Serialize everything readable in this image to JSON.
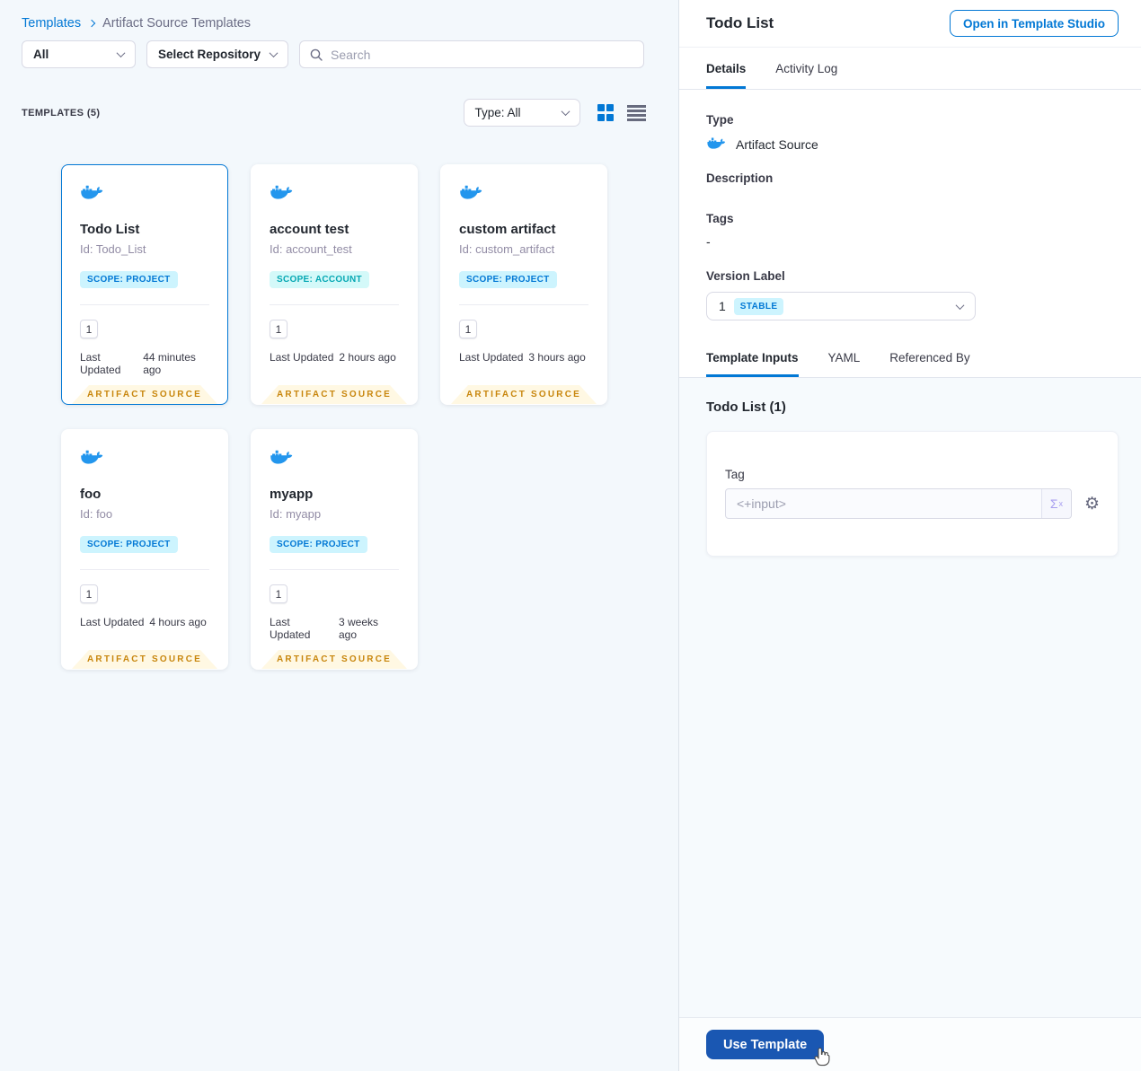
{
  "colors": {
    "primary_blue": "#0278D5",
    "docker_blue": "#2396ED",
    "ribbon_bg": "#FFF8E3",
    "ribbon_text": "#C8860D",
    "scope_project_bg": "#CDF4FE",
    "scope_project_text": "#0278D5",
    "scope_account_bg": "#D4F9F9",
    "scope_account_text": "#06A8B3",
    "use_template_bg": "#1A57B2"
  },
  "breadcrumb": {
    "root": "Templates",
    "current": "Artifact Source Templates"
  },
  "filters": {
    "scope": "All",
    "repository": "Select Repository",
    "search_placeholder": "Search"
  },
  "list_header": {
    "count": "TEMPLATES (5)",
    "type_filter": "Type: All"
  },
  "cards": [
    {
      "title": "Todo List",
      "id": "Id: Todo_List",
      "scope": "project",
      "scope_label": "SCOPE: PROJECT",
      "versions": "1",
      "updated_label": "Last Updated",
      "updated": "44 minutes ago",
      "ribbon": "ARTIFACT SOURCE"
    },
    {
      "title": "account test",
      "id": "Id: account_test",
      "scope": "account",
      "scope_label": "SCOPE: ACCOUNT",
      "versions": "1",
      "updated_label": "Last Updated",
      "updated": "2 hours ago",
      "ribbon": "ARTIFACT SOURCE"
    },
    {
      "title": "custom artifact",
      "id": "Id: custom_artifact",
      "scope": "project",
      "scope_label": "SCOPE: PROJECT",
      "versions": "1",
      "updated_label": "Last Updated",
      "updated": "3 hours ago",
      "ribbon": "ARTIFACT SOURCE"
    },
    {
      "title": "foo",
      "id": "Id: foo",
      "scope": "project",
      "scope_label": "SCOPE: PROJECT",
      "versions": "1",
      "updated_label": "Last Updated",
      "updated": "4 hours ago",
      "ribbon": "ARTIFACT SOURCE"
    },
    {
      "title": "myapp",
      "id": "Id: myapp",
      "scope": "project",
      "scope_label": "SCOPE: PROJECT",
      "versions": "1",
      "updated_label": "Last Updated",
      "updated": "3 weeks ago",
      "ribbon": "ARTIFACT SOURCE"
    }
  ],
  "panel": {
    "title": "Todo List",
    "open_button": "Open in Template Studio",
    "tabs": {
      "details": "Details",
      "activity": "Activity Log"
    },
    "fields": {
      "type_label": "Type",
      "type_value": "Artifact Source",
      "description_label": "Description",
      "tags_label": "Tags",
      "tags_value": "-",
      "version_label": "Version Label",
      "version_value": "1",
      "version_badge": "STABLE"
    },
    "sub_tabs": {
      "inputs": "Template Inputs",
      "yaml": "YAML",
      "referenced": "Referenced By"
    },
    "inputs": {
      "heading": "Todo List (1)",
      "tag_label": "Tag",
      "tag_value": "<+input>",
      "expression_icon": "Σ",
      "expression_sup": "x"
    },
    "footer": {
      "use_button": "Use Template"
    }
  },
  "icons": {
    "gear": "⚙"
  }
}
